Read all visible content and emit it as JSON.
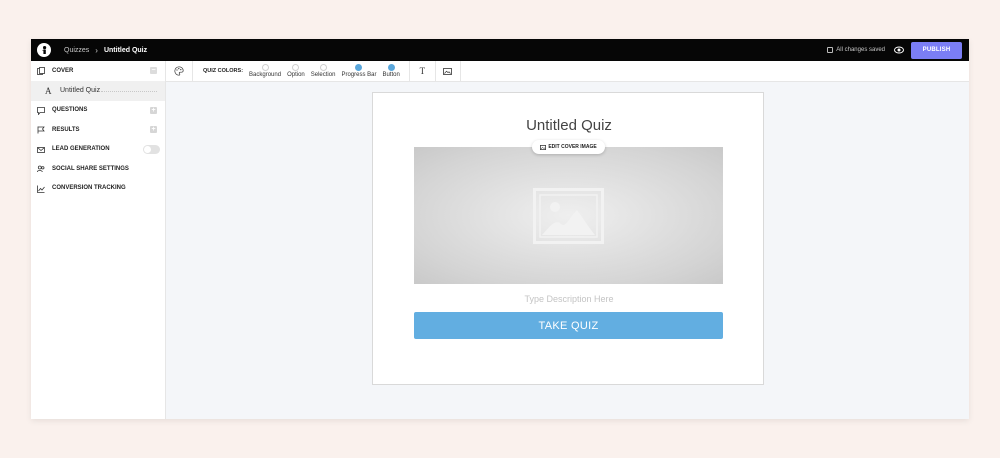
{
  "header": {
    "breadcrumb_parent": "Quizzes",
    "breadcrumb_sep": "›",
    "breadcrumb_current": "Untitled Quiz",
    "saved_status": "All changes saved",
    "publish_label": "PUBLISH"
  },
  "sidebar": {
    "items": [
      {
        "label": "COVER",
        "icon": "copy-icon"
      },
      {
        "label": "QUESTIONS",
        "icon": "chat-icon"
      },
      {
        "label": "RESULTS",
        "icon": "flag-icon"
      },
      {
        "label": "LEAD GENERATION",
        "icon": "envelope-icon"
      },
      {
        "label": "SOCIAL SHARE SETTINGS",
        "icon": "users-icon"
      },
      {
        "label": "CONVERSION TRACKING",
        "icon": "chart-icon"
      }
    ],
    "sub_item": {
      "glyph": "A",
      "label": "Untitled Quiz"
    }
  },
  "toolbar": {
    "quiz_colors_label": "QUIZ COLORS:",
    "colors": [
      {
        "name": "Background",
        "color": "#ffffff"
      },
      {
        "name": "Option",
        "color": "#ffffff"
      },
      {
        "name": "Selection",
        "color": "#ffffff"
      },
      {
        "name": "Progress Bar",
        "color": "#5aa7dc"
      },
      {
        "name": "Button",
        "color": "#5aa7dc"
      }
    ],
    "text_glyph": "T"
  },
  "quiz": {
    "title": "Untitled Quiz",
    "edit_cover_label": "EDIT COVER IMAGE",
    "description_placeholder": "Type Description Here",
    "button_label": "TAKE QUIZ",
    "button_color": "#62aee1"
  },
  "colors": {
    "accent": "#7b7ef5",
    "topbar": "#060606"
  }
}
